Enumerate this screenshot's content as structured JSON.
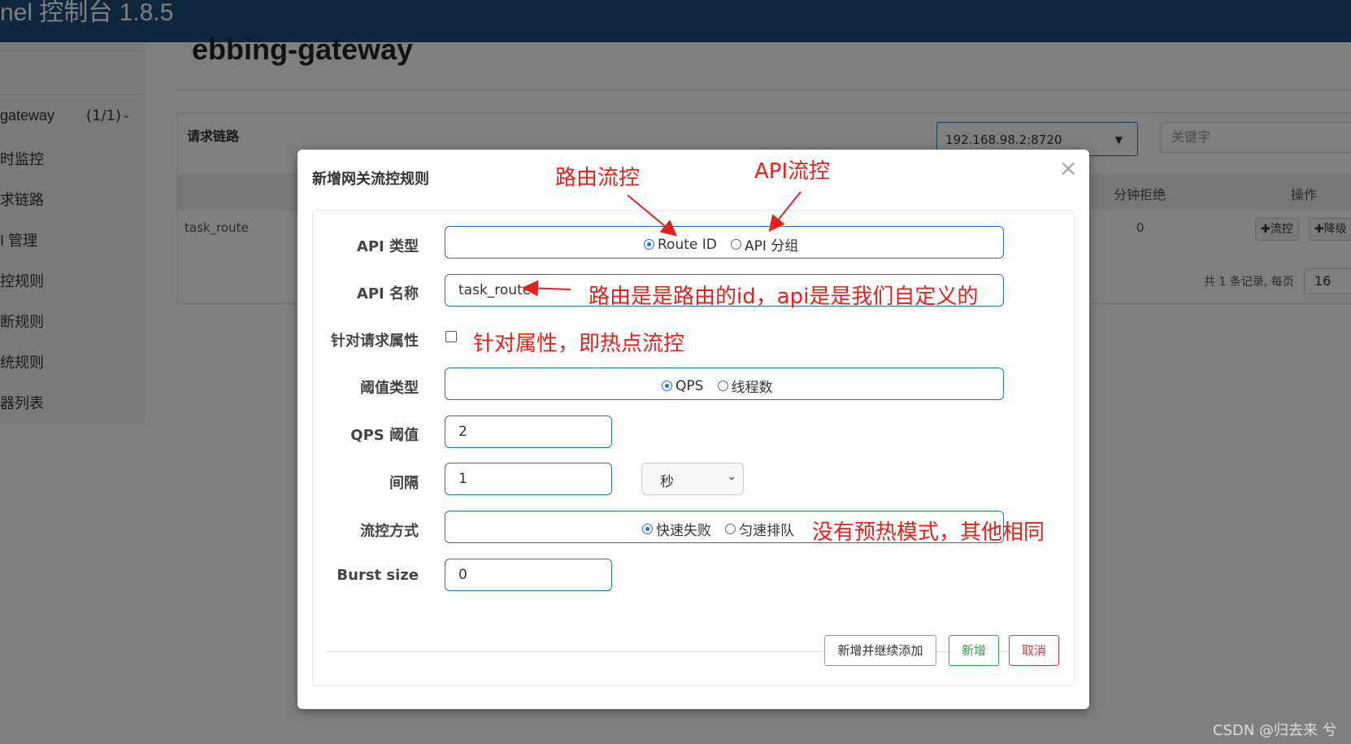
{
  "app": {
    "title": "nel 控制台 1.8.5",
    "page_title": "ebbing-gateway"
  },
  "sidebar": {
    "app_name": "gateway",
    "app_count": "(1/1)",
    "items": [
      "时监控",
      "求链路",
      "I 管理",
      "控规则",
      "断规则",
      "统规则",
      "器列表"
    ]
  },
  "panel": {
    "title": "请求链路",
    "machine": "192.168.98.2:8720",
    "keyword_placeholder": "关键字",
    "columns": [
      "分钟拒绝",
      "操作"
    ],
    "rows": [
      {
        "resource": "task_route",
        "rejected": "0"
      }
    ],
    "actions": [
      "流控",
      "降级"
    ],
    "pagination": "共 1 条记录, 每页",
    "page_size": "16"
  },
  "modal": {
    "title": "新增网关流控规则",
    "close": "×",
    "api_type": {
      "label": "API 类型",
      "options": [
        "Route ID",
        "API 分组"
      ],
      "selected": "Route ID"
    },
    "api_name": {
      "label": "API 名称",
      "value": "task_route"
    },
    "request_attr": {
      "label": "针对请求属性",
      "checked": false
    },
    "threshold_type": {
      "label": "阈值类型",
      "options": [
        "QPS",
        "线程数"
      ],
      "selected": "QPS"
    },
    "qps_threshold": {
      "label": "QPS 阈值",
      "value": "2"
    },
    "interval": {
      "label": "间隔",
      "value": "1",
      "unit": "秒"
    },
    "control_mode": {
      "label": "流控方式",
      "options": [
        "快速失败",
        "匀速排队"
      ],
      "selected": "快速失败"
    },
    "burst_size": {
      "label": "Burst size",
      "value": "0"
    },
    "buttons": {
      "add_continue": "新增并继续添加",
      "add": "新增",
      "cancel": "取消"
    }
  },
  "annotations": {
    "route_control": "路由流控",
    "api_control": "API流控",
    "route_explain": "路由是是路由的id，api是是我们自定义的",
    "attr_explain": "针对属性，即热点流控",
    "mode_explain": "没有预热模式，其他相同",
    "color": "#e62117"
  },
  "watermark": "CSDN @归去来 兮"
}
